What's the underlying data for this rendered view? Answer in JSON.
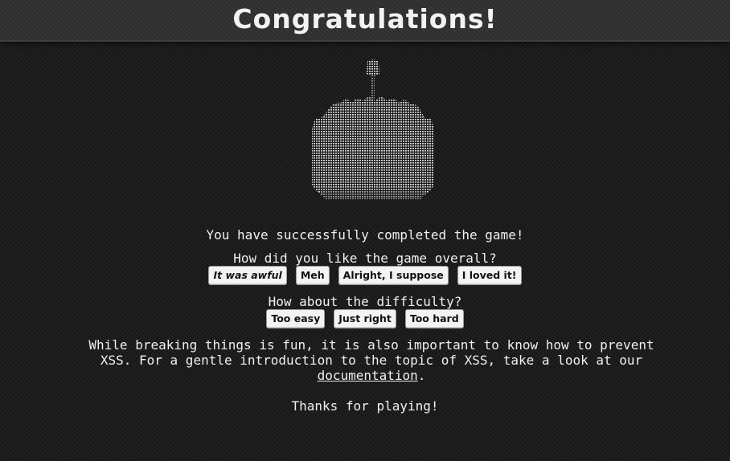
{
  "header": {
    "title": "Congratulations!"
  },
  "main": {
    "completed_text": "You have successfully completed the game!",
    "overall_question": "How did you like the game overall?",
    "overall_options": [
      "It was awful",
      "Meh",
      "Alright, I suppose",
      "I loved it!"
    ],
    "difficulty_question": "How about the difficulty?",
    "difficulty_options": [
      "Too easy",
      "Just right",
      "Too hard"
    ],
    "xss_text_1": "While breaking things is fun, it is also important to know how to prevent XSS. For a gentle introduction to the topic of XSS, take a look at our",
    "documentation_link": "documentation",
    "xss_text_end": ".",
    "thanks_text": "Thanks for playing!"
  },
  "colors": {
    "background": "#1c1c1c",
    "text": "#f0f0f0",
    "button_bg": "#f3f3f3"
  },
  "icons": {
    "cake": "ascii-cake-icon"
  }
}
